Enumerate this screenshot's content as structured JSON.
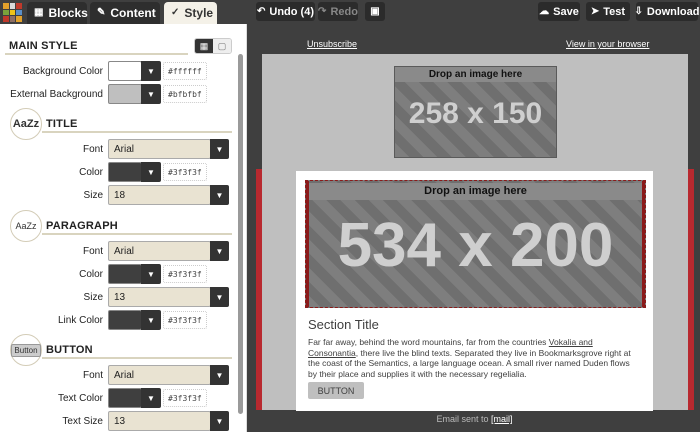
{
  "toolbar": {
    "tabs": [
      {
        "label": "Blocks",
        "icon": "cubes-icon"
      },
      {
        "label": "Content",
        "icon": "pencil-icon"
      },
      {
        "label": "Style",
        "icon": "brush-icon"
      }
    ],
    "undo_label": "Undo (4)",
    "redo_label": "Redo",
    "save_label": "Save",
    "test_label": "Test",
    "download_label": "Download"
  },
  "panel": {
    "main_style_title": "MAIN STYLE",
    "background_color": {
      "label": "Background Color",
      "value": "#ffffff"
    },
    "external_background": {
      "label": "External Background",
      "value": "#bfbfbf"
    },
    "title_section": {
      "heading": "TITLE",
      "icon_text": "AaZz",
      "font": {
        "label": "Font",
        "value": "Arial"
      },
      "color": {
        "label": "Color",
        "value": "#3f3f3f"
      },
      "size": {
        "label": "Size",
        "value": "18"
      }
    },
    "paragraph_section": {
      "heading": "PARAGRAPH",
      "icon_text": "AaZz",
      "font": {
        "label": "Font",
        "value": "Arial"
      },
      "color": {
        "label": "Color",
        "value": "#3f3f3f"
      },
      "size": {
        "label": "Size",
        "value": "13"
      },
      "link_color": {
        "label": "Link Color",
        "value": "#3f3f3f"
      }
    },
    "button_section": {
      "heading": "BUTTON",
      "icon_text": "Button",
      "font": {
        "label": "Font",
        "value": "Arial"
      },
      "text_color": {
        "label": "Text Color",
        "value": "#3f3f3f"
      },
      "text_size": {
        "label": "Text Size",
        "value": "13"
      }
    }
  },
  "preview": {
    "unsubscribe": "Unsubscribe",
    "view_in_browser": "View in your browser",
    "image1": {
      "drop_label": "Drop an image here",
      "size_label": "258 x 150"
    },
    "image2": {
      "drop_label": "Drop an image here",
      "size_label": "534 x 200"
    },
    "section_title": "Section Title",
    "body_part1": "Far far away, behind the word mountains, far from the countries ",
    "body_link": "Vokalia and Consonantia",
    "body_part2": ", there live the blind texts. Separated they live in Bookmarksgrove right at the coast of the Semantics, a large language ocean. A small river named Duden flows by their place and supplies it with the necessary regelialia.",
    "button_label": "BUTTON",
    "footer_text": "Email sent to ",
    "footer_link": "[mail]"
  },
  "colors": {
    "dark": "#3f3f3f",
    "panel_bg": "#ffffff",
    "accent_red": "#b8292f",
    "external_bg": "#bfbfbf"
  }
}
